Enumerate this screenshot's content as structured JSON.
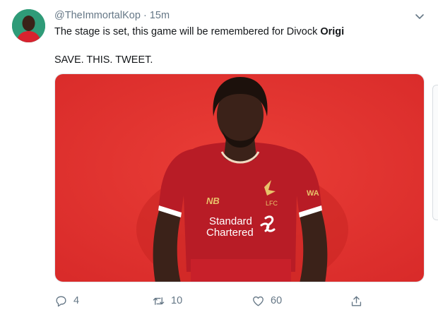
{
  "tweet": {
    "handle": "@TheImmortalKop",
    "separator": "·",
    "time": "15m",
    "text_main": "The stage is set, this game will be remembered for Divock ",
    "text_bold": "Origi",
    "text_second": "SAVE. THIS. TWEET.",
    "media": {
      "sponsor_line1": "Standard",
      "sponsor_line2": "Chartered",
      "kit_brand": "NB",
      "crest_text": "LFC",
      "sleeve_text": "WA"
    }
  },
  "actions": {
    "reply_count": "4",
    "retweet_count": "10",
    "like_count": "60"
  },
  "colors": {
    "accent": "#1da1f2",
    "muted": "#657786",
    "media_background": "#e1332f",
    "kit_red": "#b81c26"
  },
  "icons": [
    "chevron-down-icon",
    "reply-icon",
    "retweet-icon",
    "like-icon",
    "share-icon"
  ]
}
